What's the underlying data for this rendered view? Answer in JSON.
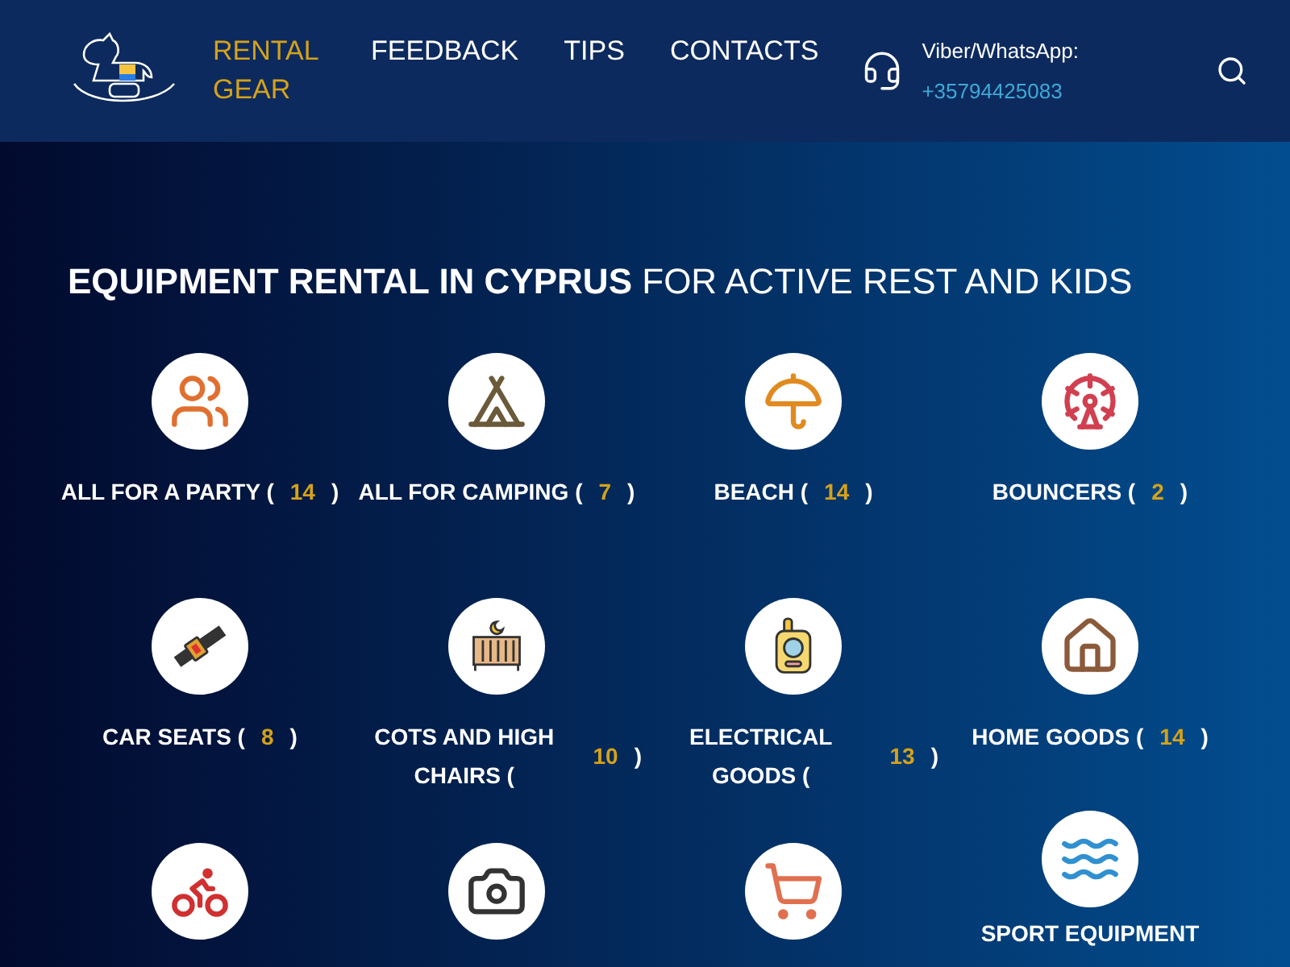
{
  "header": {
    "nav": [
      {
        "label": "RENTAL GEAR",
        "selected": true
      },
      {
        "label": "FEEDBACK",
        "selected": false
      },
      {
        "label": "TIPS",
        "selected": false
      },
      {
        "label": "CONTACTS",
        "selected": false
      }
    ],
    "contact": {
      "label": "Viber/WhatsApp:",
      "phone": "+35794425083"
    }
  },
  "heading": {
    "bold": "EQUIPMENT RENTAL IN CYPRUS",
    "rest": "FOR ACTIVE REST AND KIDS"
  },
  "categories": [
    {
      "name": "ALL FOR A PARTY (",
      "count": "14",
      "close": ")"
    },
    {
      "name": "ALL FOR CAMPING (",
      "count": "7",
      "close": ")"
    },
    {
      "name": "BEACH (",
      "count": "14",
      "close": ")"
    },
    {
      "name": "BOUNCERS (",
      "count": "2",
      "close": ")"
    },
    {
      "name": "CAR SEATS (",
      "count": "8",
      "close": ")"
    },
    {
      "name": "COTS AND HIGH CHAIRS (",
      "count": "10",
      "close": ")"
    },
    {
      "name": "ELECTRICAL GOODS (",
      "count": "13",
      "close": ")"
    },
    {
      "name": "HOME GOODS (",
      "count": "14",
      "close": ")"
    },
    {
      "kind": "icon_only"
    },
    {
      "kind": "icon_only"
    },
    {
      "kind": "icon_only"
    },
    {
      "kind": "labelled",
      "name": "SPORT EQUIPMENT"
    }
  ]
}
